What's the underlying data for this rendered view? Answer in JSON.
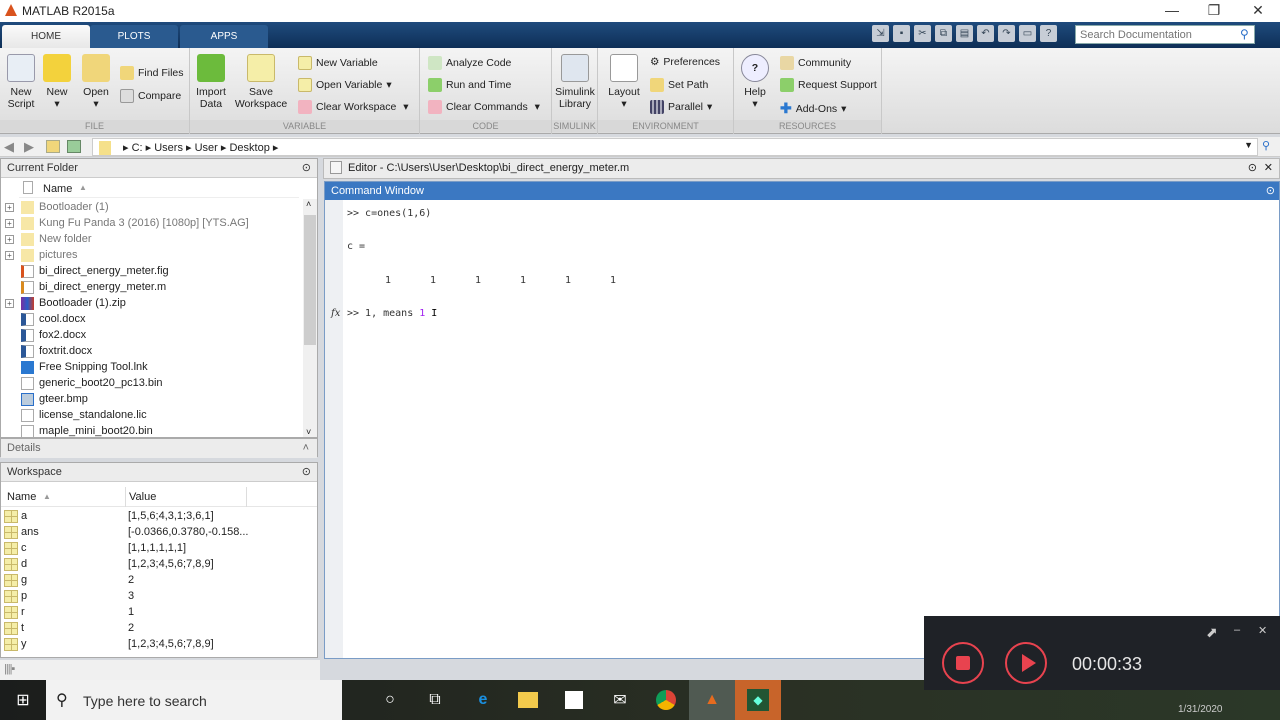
{
  "window": {
    "title": "MATLAB R2015a",
    "minimize": "—",
    "restore": "❐",
    "close": "✕"
  },
  "tabs": [
    {
      "label": "HOME",
      "active": true
    },
    {
      "label": "PLOTS"
    },
    {
      "label": "APPS"
    }
  ],
  "search": {
    "placeholder": "Search Documentation"
  },
  "ribbon": {
    "file": {
      "label": "FILE",
      "new_script": "New Script",
      "new": "New",
      "open": "Open",
      "find_files": "Find Files",
      "compare": "Compare"
    },
    "variable": {
      "label": "VARIABLE",
      "import_data": "Import Data",
      "save_workspace": "Save Workspace",
      "new_variable": "New Variable",
      "open_variable": "Open Variable",
      "clear_workspace": "Clear Workspace"
    },
    "code": {
      "label": "CODE",
      "analyze_code": "Analyze Code",
      "run_and_time": "Run and Time",
      "clear_commands": "Clear Commands"
    },
    "simulink": {
      "label": "SIMULINK",
      "simulink_library": "Simulink Library"
    },
    "environment": {
      "label": "ENVIRONMENT",
      "layout": "Layout",
      "preferences": "Preferences",
      "set_path": "Set Path",
      "parallel": "Parallel"
    },
    "resources": {
      "label": "RESOURCES",
      "help": "Help",
      "community": "Community",
      "request_support": "Request Support",
      "add_ons": "Add-Ons"
    }
  },
  "path": [
    "C:",
    "Users",
    "User",
    "Desktop"
  ],
  "current_folder": {
    "title": "Current Folder",
    "name_header": "Name",
    "items": [
      {
        "name": "Bootloader (1)",
        "type": "folder"
      },
      {
        "name": "Kung Fu Panda 3 (2016) [1080p] [YTS.AG]",
        "type": "folder"
      },
      {
        "name": "New folder",
        "type": "folder"
      },
      {
        "name": "pictures",
        "type": "folder"
      },
      {
        "name": "bi_direct_energy_meter.fig",
        "type": "fig"
      },
      {
        "name": "bi_direct_energy_meter.m",
        "type": "m"
      },
      {
        "name": "Bootloader (1).zip",
        "type": "zip"
      },
      {
        "name": "cool.docx",
        "type": "docx"
      },
      {
        "name": "fox2.docx",
        "type": "docx"
      },
      {
        "name": "foxtrit.docx",
        "type": "docx"
      },
      {
        "name": "Free Snipping Tool.lnk",
        "type": "lnk"
      },
      {
        "name": "generic_boot20_pc13.bin",
        "type": "file"
      },
      {
        "name": "gteer.bmp",
        "type": "bmp"
      },
      {
        "name": "license_standalone.lic",
        "type": "file"
      },
      {
        "name": "maple_mini_boot20.bin",
        "type": "file"
      }
    ]
  },
  "details": {
    "title": "Details"
  },
  "workspace": {
    "title": "Workspace",
    "name_header": "Name",
    "value_header": "Value",
    "vars": [
      {
        "name": "a",
        "value": "[1,5,6;4,3,1;3,6,1]"
      },
      {
        "name": "ans",
        "value": "[-0.0366,0.3780,-0.158..."
      },
      {
        "name": "c",
        "value": "[1,1,1,1,1,1]"
      },
      {
        "name": "d",
        "value": "[1,2,3;4,5,6;7,8,9]"
      },
      {
        "name": "g",
        "value": "2"
      },
      {
        "name": "p",
        "value": "3"
      },
      {
        "name": "r",
        "value": "1"
      },
      {
        "name": "t",
        "value": "2"
      },
      {
        "name": "y",
        "value": "[1,2,3;4,5,6;7,8,9]"
      }
    ]
  },
  "editor": {
    "title": "Editor - C:\\Users\\User\\Desktop\\bi_direct_energy_meter.m"
  },
  "command_window": {
    "title": "Command Window",
    "line1": ">> c=ones(1,6)",
    "line2": "c =",
    "ones": [
      "1",
      "1",
      "1",
      "1",
      "1",
      "1"
    ],
    "prompt": ">> 1, means ",
    "prompt_num": "1",
    "fx": "fx"
  },
  "recorder": {
    "time": "00:00:33",
    "accent": "#e8434f"
  },
  "taskbar": {
    "search_placeholder": "Type here to search",
    "date": "1/31/2020"
  }
}
